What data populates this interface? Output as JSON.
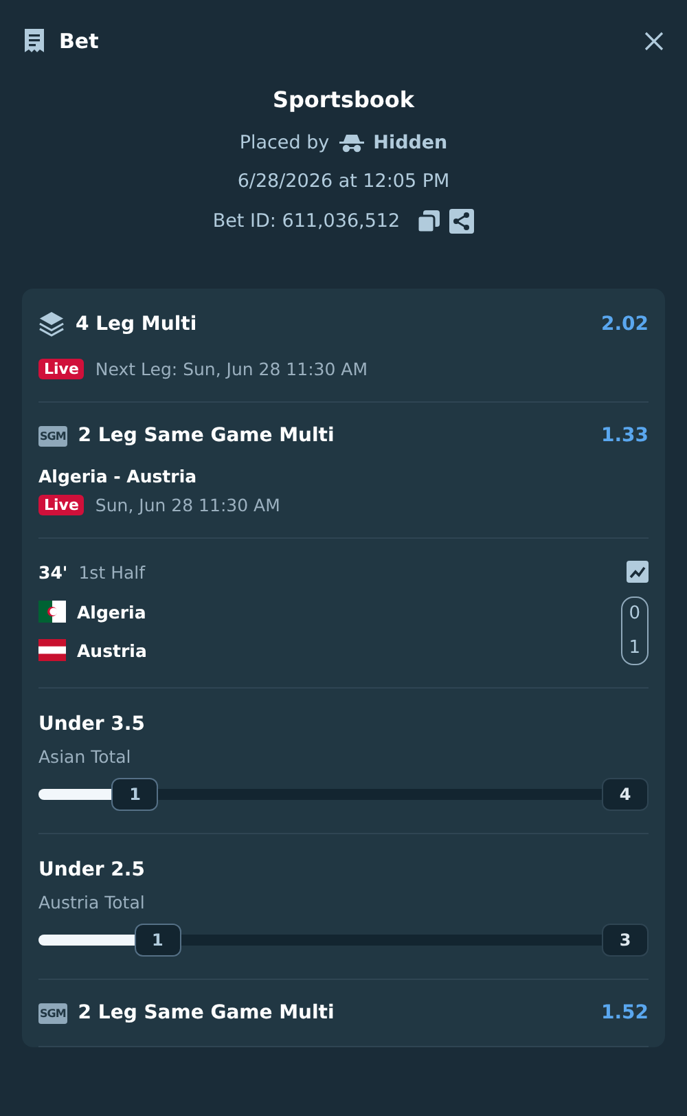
{
  "header": {
    "title": "Bet"
  },
  "summary": {
    "title": "Sportsbook",
    "placed_by_label": "Placed by",
    "placed_by_name": "Hidden",
    "date": "6/28/2026 at 12:05 PM",
    "bet_id": "Bet ID: 611,036,512"
  },
  "multi": {
    "title": "4 Leg Multi",
    "odds": "2.02",
    "live_badge": "Live",
    "next_leg": "Next Leg: Sun, Jun 28 11:30 AM"
  },
  "games": [
    {
      "icon_text": "SGM",
      "title": "2 Leg Same Game Multi",
      "odds": "1.33",
      "match": "Algeria - Austria",
      "live_badge": "Live",
      "time": "Sun, Jun 28 11:30 AM",
      "scoreboard": {
        "minute": "34'",
        "period": "1st Half",
        "teams": [
          {
            "kind": "algeria",
            "name": "Algeria",
            "score": "0"
          },
          {
            "kind": "austria",
            "name": "Austria",
            "score": "1"
          }
        ]
      },
      "legs": [
        {
          "selection": "Under 3.5",
          "market": "Asian Total",
          "level": 0.13,
          "current": "1",
          "target": "4"
        },
        {
          "selection": "Under 2.5",
          "market": "Austria Total",
          "level": 0.17,
          "current": "1",
          "target": "3"
        }
      ]
    },
    {
      "icon_text": "SGM",
      "title": "2 Leg Same Game Multi",
      "odds": "1.52"
    }
  ]
}
